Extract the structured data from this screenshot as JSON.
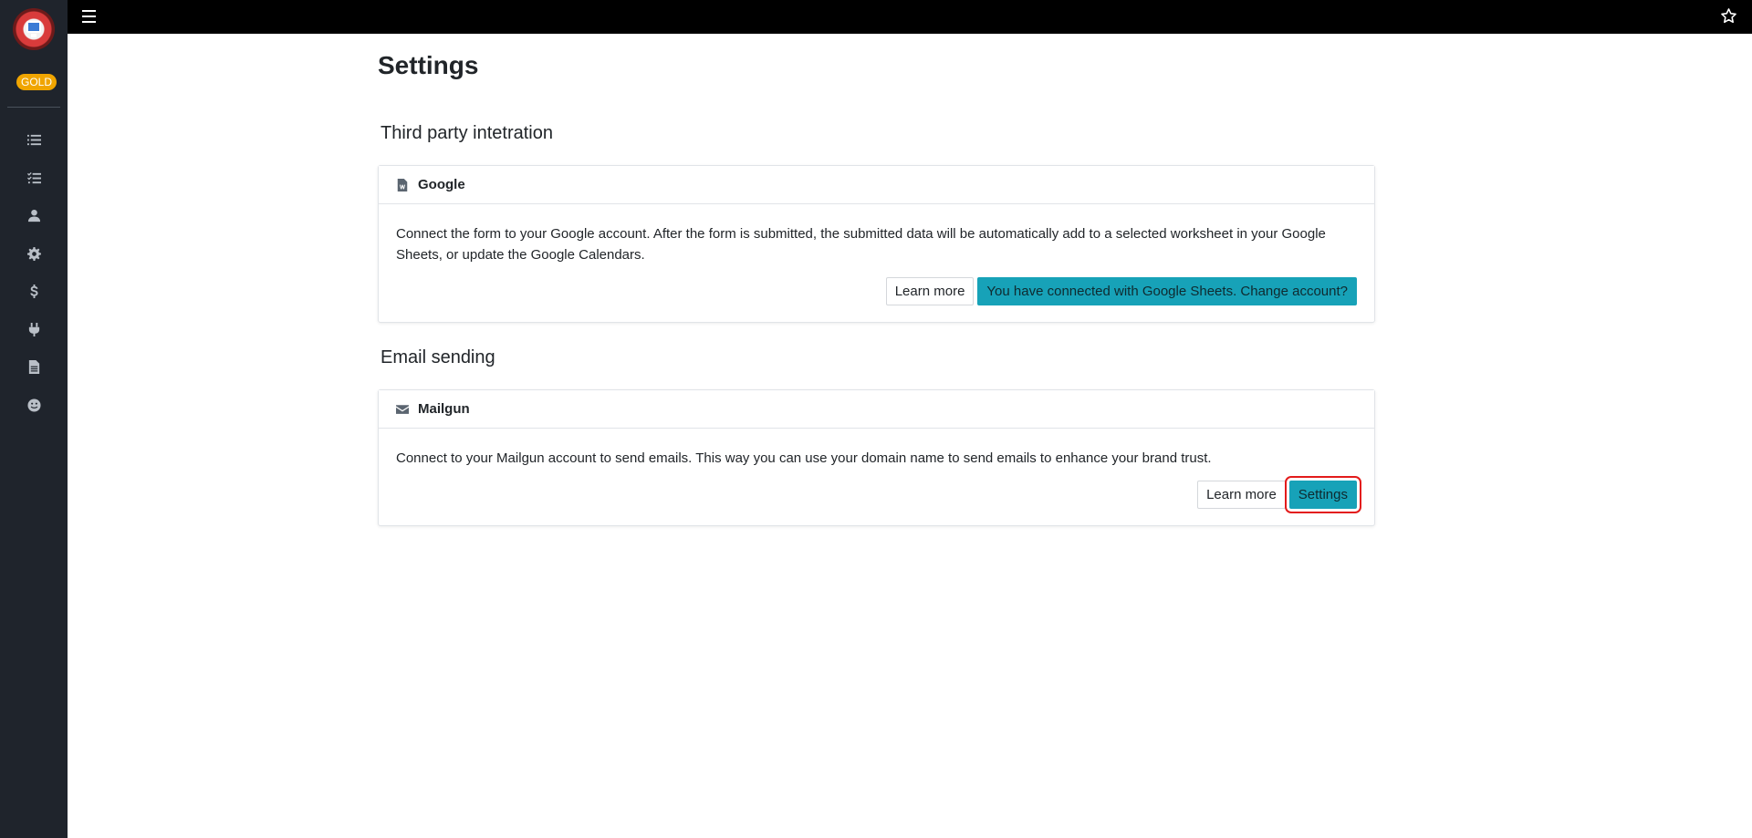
{
  "sidebar": {
    "badge": "GOLD",
    "items": [
      {
        "icon": "list-icon"
      },
      {
        "icon": "task-list-icon"
      },
      {
        "icon": "user-icon"
      },
      {
        "icon": "gear-icon"
      },
      {
        "icon": "dollar-icon"
      },
      {
        "icon": "plug-icon"
      },
      {
        "icon": "document-icon"
      },
      {
        "icon": "smile-icon"
      }
    ]
  },
  "topbar": {
    "menu_icon": "hamburger-icon",
    "favorite_icon": "star-icon"
  },
  "page": {
    "title": "Settings"
  },
  "sections": {
    "integration": {
      "title": "Third party intetration",
      "card": {
        "title": "Google",
        "icon": "word-document-icon",
        "description": "Connect the form to your Google account. After the form is submitted, the submitted data will be automatically add to a selected worksheet in your Google Sheets, or update the Google Calendars.",
        "learn_more": "Learn more",
        "action": "You have connected with Google Sheets. Change account?"
      }
    },
    "email": {
      "title": "Email sending",
      "card": {
        "title": "Mailgun",
        "icon": "envelope-icon",
        "description": "Connect to your Mailgun account to send emails. This way you can use your domain name to send emails to enhance your brand trust.",
        "learn_more": "Learn more",
        "action": "Settings"
      }
    }
  },
  "colors": {
    "sidebar_bg": "#1f242c",
    "topbar_bg": "#000000",
    "accent": "#17a2b8",
    "badge": "#f0a500",
    "highlight": "#e31b1b"
  }
}
